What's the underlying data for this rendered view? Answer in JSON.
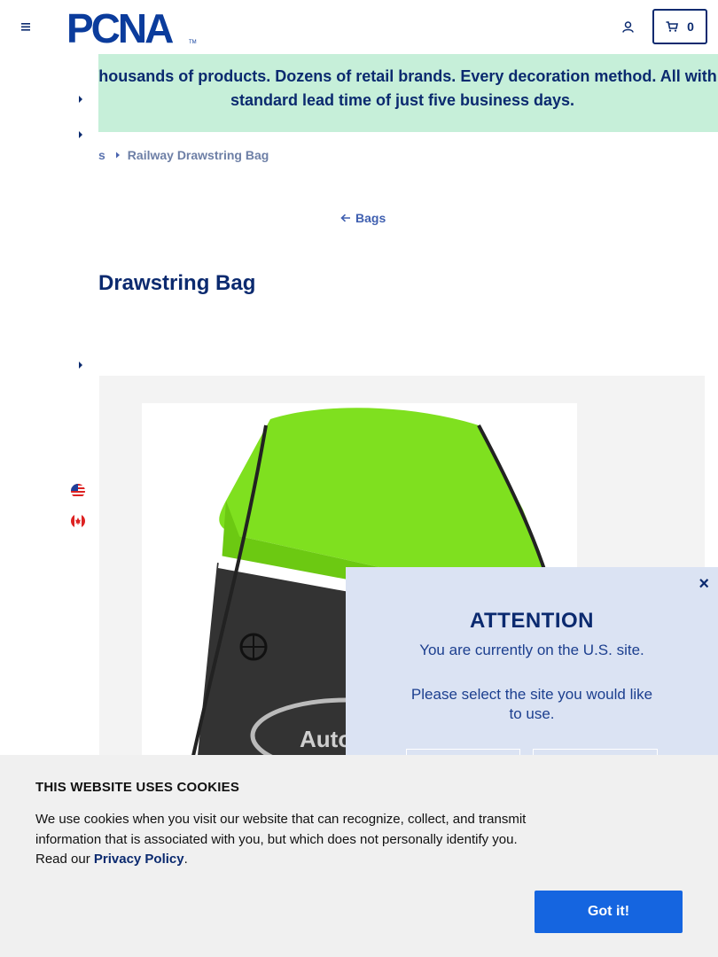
{
  "header": {
    "logo_text": "PCNA",
    "cart_count": "0"
  },
  "banner": {
    "text": "? Thousands of products. Dozens of retail brands. Every decoration method. All with a standard lead time of just five business days."
  },
  "breadcrumb": {
    "previous": "s",
    "current": "Railway Drawstring Bag"
  },
  "back_link": "Bags",
  "product": {
    "title": "Drawstring Bag",
    "image_imprint": "Auto"
  },
  "modal": {
    "title": "ATTENTION",
    "line1": "You are currently on the U.S. site.",
    "line2": "Please select the site you would like to use.",
    "close": "×"
  },
  "cookie": {
    "title": "THIS WEBSITE USES COOKIES",
    "text_before": "We use cookies when you visit our website that can recognize, collect, and transmit information that is associated with you, but which does not personally identify you. Read our ",
    "link": "Privacy Policy",
    "text_after": ".",
    "button": "Got it!"
  },
  "icons": {
    "menu": "hamburger-icon",
    "account": "user-icon",
    "cart": "cart-icon",
    "back": "arrow-left-icon",
    "caret": "caret-right-icon",
    "flag_us": "us-flag-icon",
    "flag_ca": "canada-flag-icon"
  },
  "colors": {
    "brand_navy": "#0b2a6f",
    "banner_bg": "#c6efd9",
    "modal_bg": "#dbe3f3",
    "cookie_button": "#1565e0"
  }
}
